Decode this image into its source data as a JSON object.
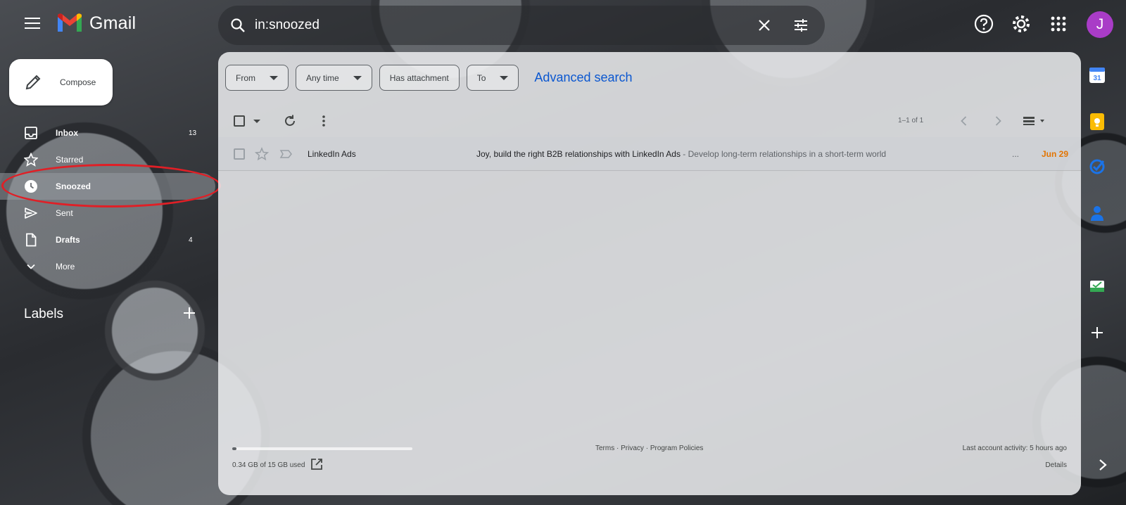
{
  "app": {
    "name": "Gmail"
  },
  "search": {
    "query": "in:snoozed"
  },
  "user": {
    "initial": "J",
    "avatar_color": "#a93cc7"
  },
  "compose": {
    "label": "Compose"
  },
  "nav": {
    "items": [
      {
        "label": "Inbox",
        "count": "13",
        "icon": "inbox-icon"
      },
      {
        "label": "Starred",
        "count": "",
        "icon": "star-icon"
      },
      {
        "label": "Snoozed",
        "count": "",
        "icon": "clock-icon"
      },
      {
        "label": "Sent",
        "count": "",
        "icon": "send-icon"
      },
      {
        "label": "Drafts",
        "count": "4",
        "icon": "draft-icon"
      },
      {
        "label": "More",
        "count": "",
        "icon": "chevron-down-icon"
      }
    ],
    "active": "Snoozed"
  },
  "labels": {
    "heading": "Labels"
  },
  "filters": {
    "from": "From",
    "any_time": "Any time",
    "has_attachment": "Has attachment",
    "to": "To",
    "advanced": "Advanced search"
  },
  "toolbar": {
    "pager": "1–1 of 1"
  },
  "emails": [
    {
      "sender": "LinkedIn Ads",
      "subject": "Joy, build the right B2B relationships with LinkedIn Ads",
      "snippet": " - Develop long-term relationships in a short-term world",
      "dots": "...",
      "date": "Jun 29"
    }
  ],
  "footer": {
    "storage": "0.34 GB of 15 GB used",
    "storage_fraction": 0.023,
    "terms": "Terms",
    "privacy": "Privacy",
    "policies": "Program Policies",
    "activity": "Last account activity: 5 hours ago",
    "details": "Details"
  },
  "colors": {
    "accent_blue": "#0b57d0",
    "date_orange": "#e37400",
    "highlight_red": "#e01f26"
  }
}
